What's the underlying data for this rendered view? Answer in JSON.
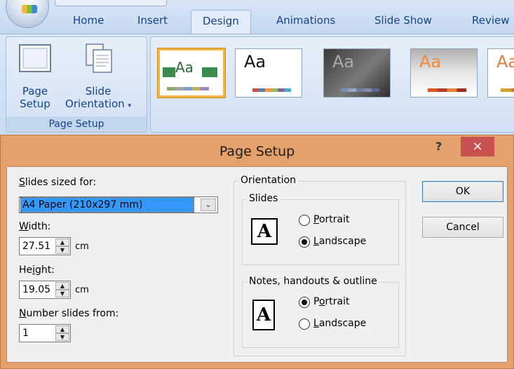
{
  "ribbon": {
    "tabs": [
      "Home",
      "Insert",
      "Design",
      "Animations",
      "Slide Show",
      "Review"
    ],
    "active_tab": "Design",
    "page_setup_group": {
      "label": "Page Setup",
      "page_setup_button": [
        "Page",
        "Setup"
      ],
      "slide_orientation_button": [
        "Slide",
        "Orientation"
      ]
    },
    "theme_sample_text": "Aa"
  },
  "dialog": {
    "title": "Page Setup",
    "help": "?",
    "close": "×",
    "slides_sized_for": {
      "label_accel": "S",
      "label_rest": "lides sized for:",
      "value": "A4 Paper (210x297 mm)"
    },
    "width": {
      "label_accel": "W",
      "label_rest": "idth:",
      "value": "27.51",
      "unit": "cm"
    },
    "height": {
      "label_pre": "He",
      "label_accel": "i",
      "label_rest": "ght:",
      "value": "19.05",
      "unit": "cm"
    },
    "number_from": {
      "label_accel": "N",
      "label_rest": "umber slides from:",
      "value": "1"
    },
    "orientation": {
      "label": "Orientation",
      "slides": {
        "label": "Slides",
        "portrait_accel": "P",
        "portrait_rest": "ortrait",
        "landscape_accel": "L",
        "landscape_rest": "andscape",
        "selected": "Landscape"
      },
      "notes": {
        "label": "Notes, handouts & outline",
        "portrait_pre": "P",
        "portrait_accel": "o",
        "portrait_rest": "rtrait",
        "landscape_accel": "L",
        "landscape_rest": "andscape",
        "selected": "Portrait"
      }
    },
    "ok": "OK",
    "cancel": "Cancel"
  }
}
